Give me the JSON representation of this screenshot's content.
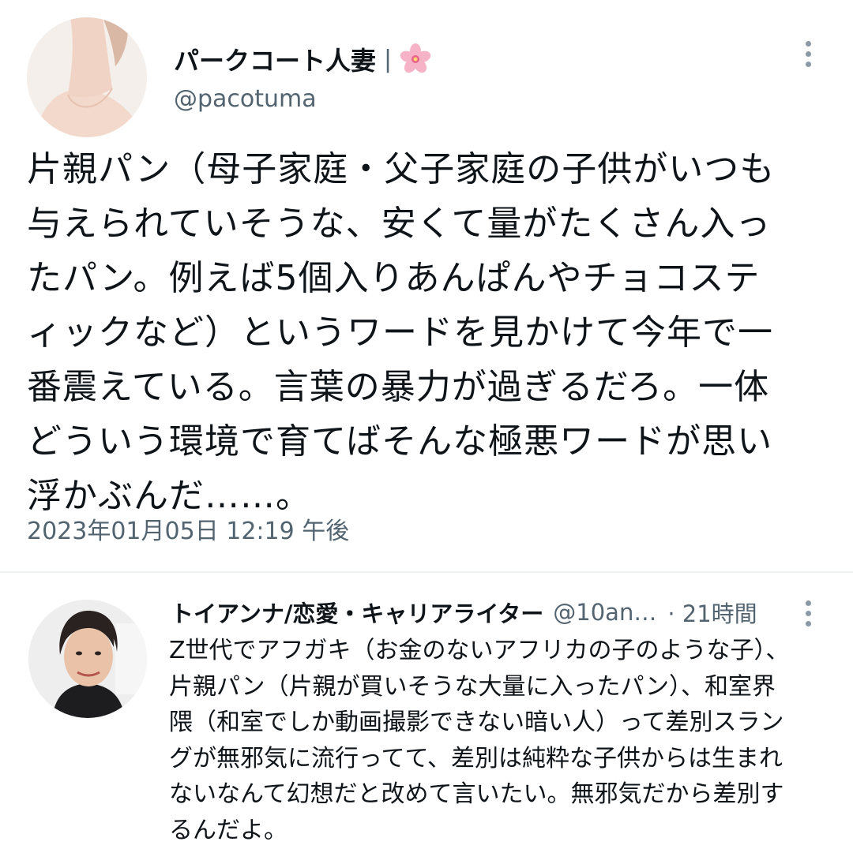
{
  "main_tweet": {
    "display_name": "パークコート人妻",
    "name_separator": "|",
    "handle": "@pacotuma",
    "text_lines": [
      "片親パン（母子家庭・父子家庭の子供がいつも",
      "与えられていそうな、安くて量がたくさん入っ",
      "たパン。例えば5個入りあんぱんやチョコステ",
      "ィックなど）というワードを見かけて今年で一",
      "番震えている。言葉の暴力が過ぎるだろ。一体",
      "どういう環境で育てばそんな極悪ワードが思い",
      "浮かぶんだ……。"
    ],
    "timestamp": "2023年01月05日 12:19 午後"
  },
  "reply_tweet": {
    "display_name": "トイアンナ/恋愛・キャリアライター",
    "handle": "@10an…",
    "time": "· 21時間",
    "text_lines": [
      "Z世代でアフガキ（お金のないアフリカの子のような子）、",
      "片親パン（片親が買いそうな大量に入ったパン）、和室界",
      "隈（和室でしか動画撮影できない暗い人）って差別スラン",
      "グが無邪気に流行ってて、差別は純粋な子供からは生まれ",
      "ないなんて幻想だと改めて言いたい。無邪気だから差別す",
      "るんだよ。"
    ]
  },
  "icons": {
    "flower": "cherry-blossom-icon",
    "more": "more-vertical-icon"
  },
  "colors": {
    "text_primary": "#0f1419",
    "text_secondary": "#536471",
    "divider": "#eff3f4",
    "flower": "#f3a6c0"
  }
}
